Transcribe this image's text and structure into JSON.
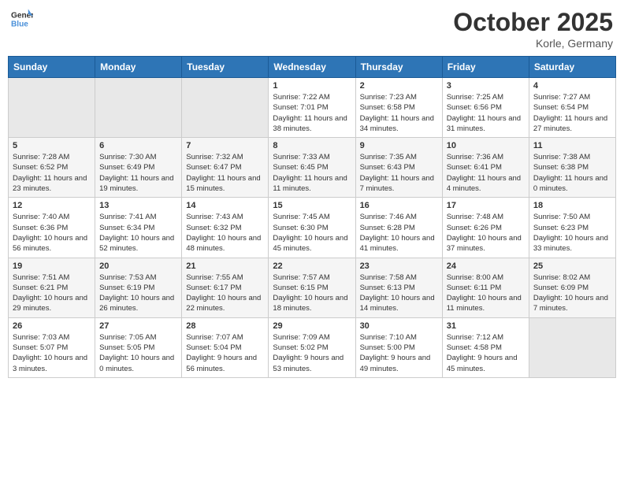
{
  "header": {
    "logo_general": "General",
    "logo_blue": "Blue",
    "month": "October 2025",
    "location": "Korle, Germany"
  },
  "weekdays": [
    "Sunday",
    "Monday",
    "Tuesday",
    "Wednesday",
    "Thursday",
    "Friday",
    "Saturday"
  ],
  "weeks": [
    [
      {
        "day": "",
        "empty": true
      },
      {
        "day": "",
        "empty": true
      },
      {
        "day": "",
        "empty": true
      },
      {
        "day": "1",
        "sunrise": "7:22 AM",
        "sunset": "7:01 PM",
        "daylight": "11 hours and 38 minutes."
      },
      {
        "day": "2",
        "sunrise": "7:23 AM",
        "sunset": "6:58 PM",
        "daylight": "11 hours and 34 minutes."
      },
      {
        "day": "3",
        "sunrise": "7:25 AM",
        "sunset": "6:56 PM",
        "daylight": "11 hours and 31 minutes."
      },
      {
        "day": "4",
        "sunrise": "7:27 AM",
        "sunset": "6:54 PM",
        "daylight": "11 hours and 27 minutes."
      }
    ],
    [
      {
        "day": "5",
        "sunrise": "7:28 AM",
        "sunset": "6:52 PM",
        "daylight": "11 hours and 23 minutes."
      },
      {
        "day": "6",
        "sunrise": "7:30 AM",
        "sunset": "6:49 PM",
        "daylight": "11 hours and 19 minutes."
      },
      {
        "day": "7",
        "sunrise": "7:32 AM",
        "sunset": "6:47 PM",
        "daylight": "11 hours and 15 minutes."
      },
      {
        "day": "8",
        "sunrise": "7:33 AM",
        "sunset": "6:45 PM",
        "daylight": "11 hours and 11 minutes."
      },
      {
        "day": "9",
        "sunrise": "7:35 AM",
        "sunset": "6:43 PM",
        "daylight": "11 hours and 7 minutes."
      },
      {
        "day": "10",
        "sunrise": "7:36 AM",
        "sunset": "6:41 PM",
        "daylight": "11 hours and 4 minutes."
      },
      {
        "day": "11",
        "sunrise": "7:38 AM",
        "sunset": "6:38 PM",
        "daylight": "11 hours and 0 minutes."
      }
    ],
    [
      {
        "day": "12",
        "sunrise": "7:40 AM",
        "sunset": "6:36 PM",
        "daylight": "10 hours and 56 minutes."
      },
      {
        "day": "13",
        "sunrise": "7:41 AM",
        "sunset": "6:34 PM",
        "daylight": "10 hours and 52 minutes."
      },
      {
        "day": "14",
        "sunrise": "7:43 AM",
        "sunset": "6:32 PM",
        "daylight": "10 hours and 48 minutes."
      },
      {
        "day": "15",
        "sunrise": "7:45 AM",
        "sunset": "6:30 PM",
        "daylight": "10 hours and 45 minutes."
      },
      {
        "day": "16",
        "sunrise": "7:46 AM",
        "sunset": "6:28 PM",
        "daylight": "10 hours and 41 minutes."
      },
      {
        "day": "17",
        "sunrise": "7:48 AM",
        "sunset": "6:26 PM",
        "daylight": "10 hours and 37 minutes."
      },
      {
        "day": "18",
        "sunrise": "7:50 AM",
        "sunset": "6:23 PM",
        "daylight": "10 hours and 33 minutes."
      }
    ],
    [
      {
        "day": "19",
        "sunrise": "7:51 AM",
        "sunset": "6:21 PM",
        "daylight": "10 hours and 29 minutes."
      },
      {
        "day": "20",
        "sunrise": "7:53 AM",
        "sunset": "6:19 PM",
        "daylight": "10 hours and 26 minutes."
      },
      {
        "day": "21",
        "sunrise": "7:55 AM",
        "sunset": "6:17 PM",
        "daylight": "10 hours and 22 minutes."
      },
      {
        "day": "22",
        "sunrise": "7:57 AM",
        "sunset": "6:15 PM",
        "daylight": "10 hours and 18 minutes."
      },
      {
        "day": "23",
        "sunrise": "7:58 AM",
        "sunset": "6:13 PM",
        "daylight": "10 hours and 14 minutes."
      },
      {
        "day": "24",
        "sunrise": "8:00 AM",
        "sunset": "6:11 PM",
        "daylight": "10 hours and 11 minutes."
      },
      {
        "day": "25",
        "sunrise": "8:02 AM",
        "sunset": "6:09 PM",
        "daylight": "10 hours and 7 minutes."
      }
    ],
    [
      {
        "day": "26",
        "sunrise": "7:03 AM",
        "sunset": "5:07 PM",
        "daylight": "10 hours and 3 minutes."
      },
      {
        "day": "27",
        "sunrise": "7:05 AM",
        "sunset": "5:05 PM",
        "daylight": "10 hours and 0 minutes."
      },
      {
        "day": "28",
        "sunrise": "7:07 AM",
        "sunset": "5:04 PM",
        "daylight": "9 hours and 56 minutes."
      },
      {
        "day": "29",
        "sunrise": "7:09 AM",
        "sunset": "5:02 PM",
        "daylight": "9 hours and 53 minutes."
      },
      {
        "day": "30",
        "sunrise": "7:10 AM",
        "sunset": "5:00 PM",
        "daylight": "9 hours and 49 minutes."
      },
      {
        "day": "31",
        "sunrise": "7:12 AM",
        "sunset": "4:58 PM",
        "daylight": "9 hours and 45 minutes."
      },
      {
        "day": "",
        "empty": true
      }
    ]
  ]
}
